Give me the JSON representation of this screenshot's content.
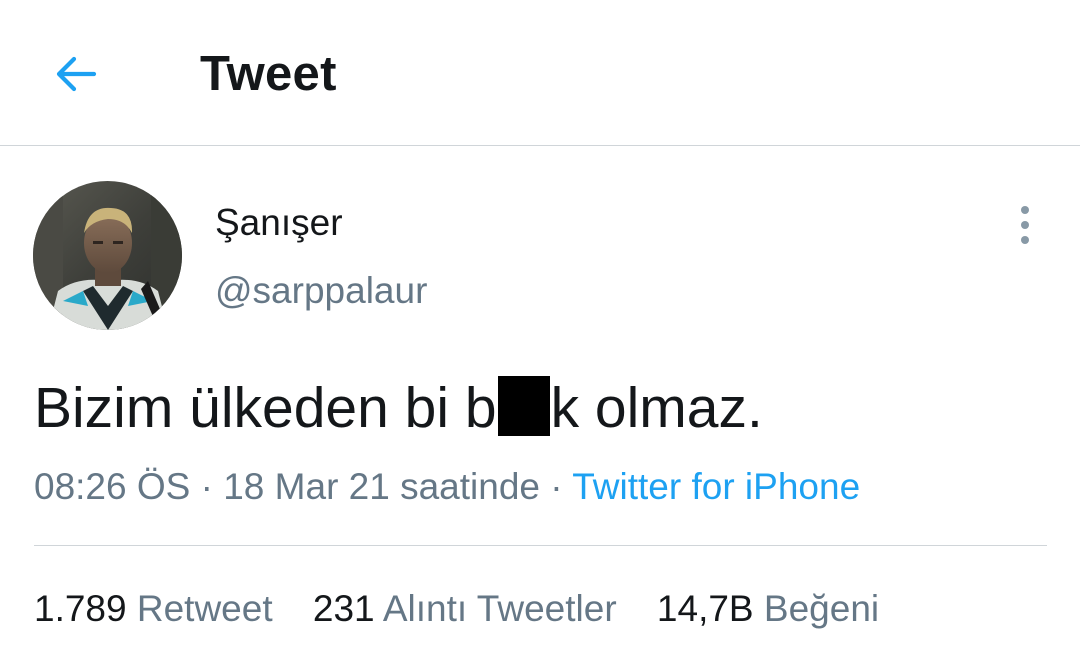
{
  "header": {
    "back_icon": "arrow-left-icon",
    "title": "Tweet"
  },
  "colors": {
    "accent": "#1da1f2",
    "text_primary": "#14171a",
    "text_secondary": "#657786",
    "divider": "#d0d5d9"
  },
  "author": {
    "display_name": "Şanışer",
    "handle": "@sarppalaur",
    "more_icon": "more-vertical-icon"
  },
  "tweet": {
    "text_before_redaction": "Bizim ülkeden bi b",
    "text_after_redaction": "k olmaz.",
    "time": "08:26 ÖS",
    "date": "18 Mar 21 saatinde",
    "separator": "·",
    "source": "Twitter for iPhone"
  },
  "stats": {
    "retweets_count": "1.789",
    "retweets_label": "Retweet",
    "quotes_count": "231",
    "quotes_label": "Alıntı Tweetler",
    "likes_count": "14,7B",
    "likes_label": "Beğeni"
  }
}
